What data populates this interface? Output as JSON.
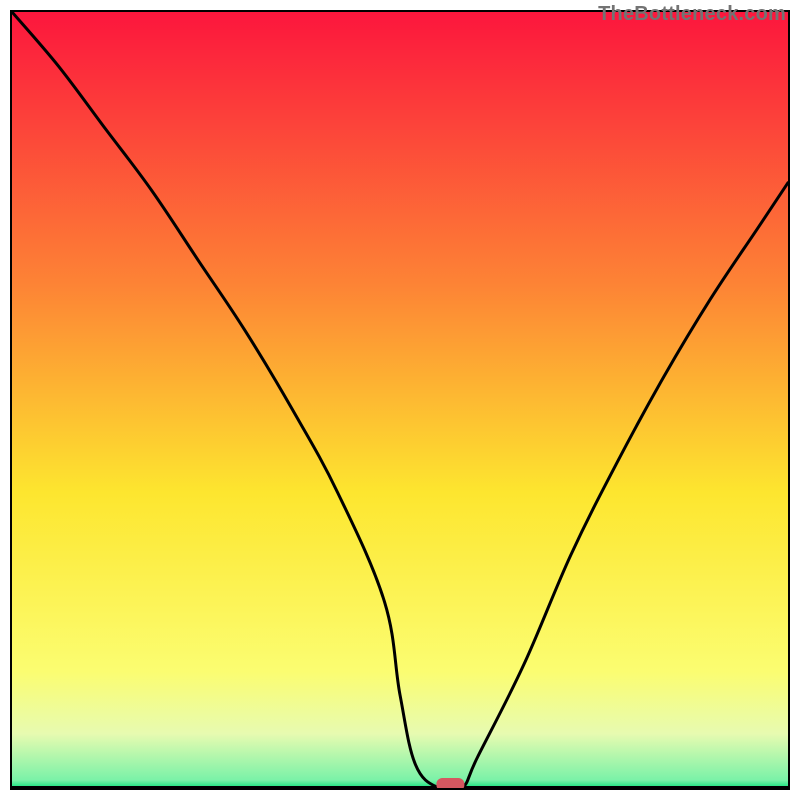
{
  "watermark": "TheBottleneck.com",
  "chart_data": {
    "type": "line",
    "title": "",
    "xlabel": "",
    "ylabel": "",
    "xlim": [
      0,
      100
    ],
    "ylim": [
      0,
      100
    ],
    "legend": false,
    "grid": false,
    "background_gradient": {
      "top": "#fc163d",
      "mid_upper": "#fd8335",
      "mid": "#fde62f",
      "mid_lower": "#fbfd71",
      "near_bottom": "#e7fbb0",
      "bottom": "#0fe47b"
    },
    "series": [
      {
        "name": "bottleneck-curve",
        "color": "#000000",
        "x": [
          0,
          6,
          12,
          18,
          24,
          30,
          36,
          42,
          48,
          50,
          52,
          55,
          58,
          60,
          66,
          72,
          78,
          84,
          90,
          96,
          100
        ],
        "y": [
          100,
          93,
          85,
          77,
          68,
          59,
          49,
          38,
          24,
          12,
          3,
          0,
          0,
          4,
          16,
          30,
          42,
          53,
          63,
          72,
          78
        ]
      }
    ],
    "marker": {
      "name": "bottleneck-point",
      "x": 56.5,
      "y": 0,
      "color": "#d55860",
      "shape": "rounded-bar"
    }
  }
}
